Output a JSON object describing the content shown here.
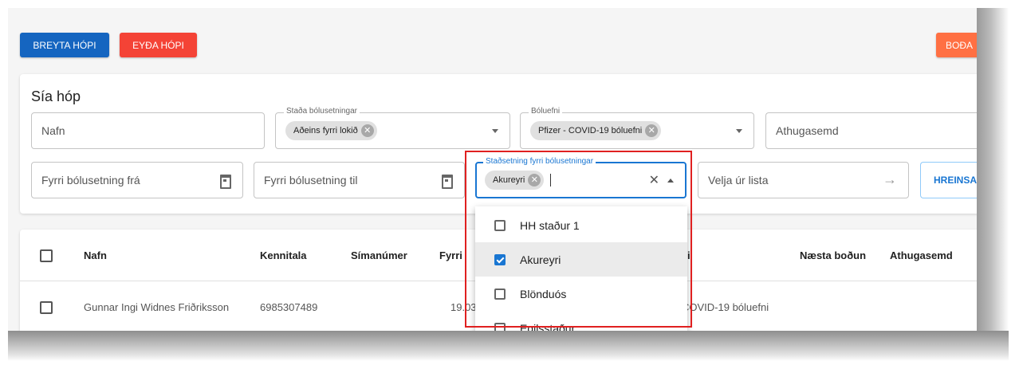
{
  "toolbar": {
    "edit_group": "BREYTA HÓPI",
    "delete_group": "EYÐA HÓPI",
    "invite": "BOÐA"
  },
  "filter": {
    "title": "Sía hóp",
    "name_placeholder": "Nafn",
    "status_label": "Staða bólusetningar",
    "status_chip": "Aðeins fyrri lokið",
    "vaccine_label": "Bóluefni",
    "vaccine_chip": "Pfizer - COVID-19 bóluefni",
    "note_placeholder": "Athugasemd",
    "first_from": "Fyrri bólusetning frá",
    "first_to": "Fyrri bólusetning til",
    "location_label": "Staðsetning fyrri bólusetningar",
    "location_chip": "Akureyri",
    "pick_list": "Velja úr lista",
    "clear_button": "HREINSA"
  },
  "dropdown": {
    "options": [
      {
        "label": "HH staður 1",
        "checked": false
      },
      {
        "label": "Akureyri",
        "checked": true
      },
      {
        "label": "Blönduós",
        "checked": false
      },
      {
        "label": "Egilsstaður",
        "checked": false
      }
    ]
  },
  "table": {
    "headers": [
      "Nafn",
      "Kennitala",
      "Símanúmer",
      "Fyrri",
      "i",
      "Næsta boðun",
      "Athugasemd"
    ],
    "rows": [
      {
        "name": "Gunnar Ingi Widnes Friðriksson",
        "kennitala": "6985307489",
        "phone": "",
        "first": "19.03",
        "vaccine": "COVID-19 bóluefni"
      }
    ]
  },
  "colors": {
    "primary": "#1565c0",
    "danger": "#f44336",
    "warning": "#ff7043",
    "highlight_box": "#e02020",
    "focus": "#1976d2"
  }
}
